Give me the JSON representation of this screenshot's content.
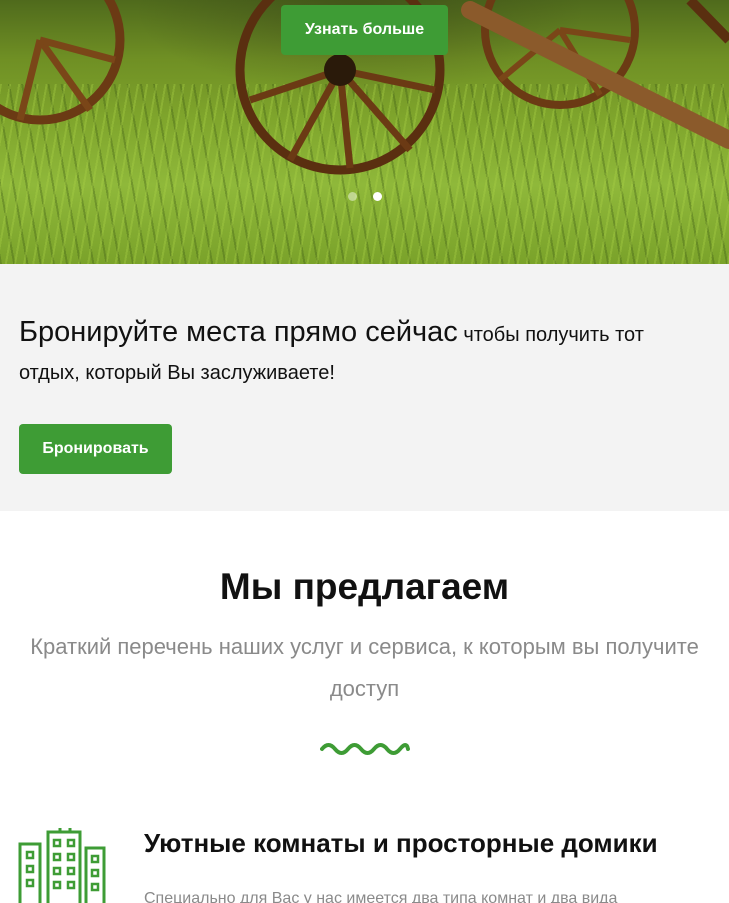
{
  "hero": {
    "button_label": "Узнать больше",
    "slides": [
      {
        "active": false
      },
      {
        "active": true
      }
    ]
  },
  "booking": {
    "headline": "Бронируйте места прямо сейчас",
    "subtext": " чтобы получить тот отдых, который Вы заслуживаете!",
    "button_label": "Бронировать"
  },
  "offer": {
    "title": "Мы предлагаем",
    "subtitle": "Краткий перечень наших услуг и сервиса, к которым вы получите доступ"
  },
  "features": [
    {
      "icon": "buildings-icon",
      "title": "Уютные комнаты и просторные домики",
      "description": "Специально для Вас у нас имеется два типа комнат и два вида"
    }
  ],
  "colors": {
    "accent": "#3e9c35",
    "band_bg": "#f3f3f3",
    "muted_text": "#8a8a8a"
  }
}
